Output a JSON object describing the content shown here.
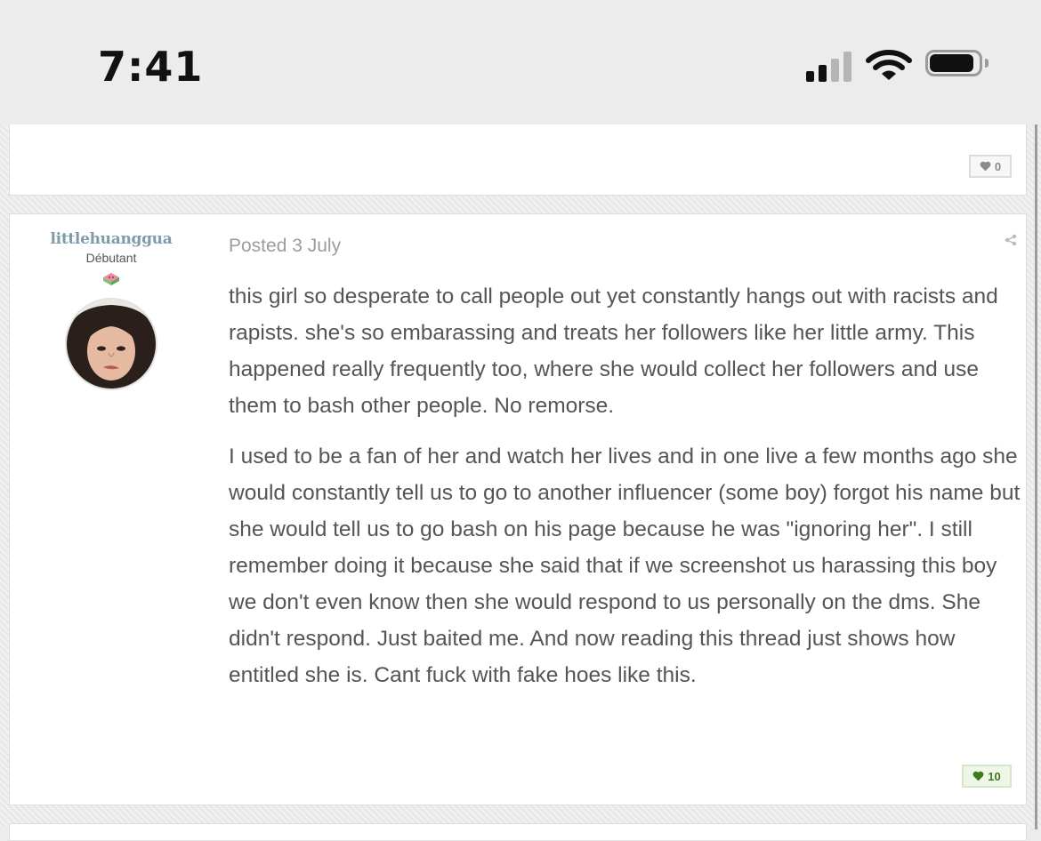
{
  "status_bar": {
    "time": "7:41",
    "signal_bars_active": 2,
    "signal_bars_total": 4,
    "battery_level": 0.9
  },
  "previous_post": {
    "reaction_count": "0"
  },
  "post": {
    "author": {
      "username": "littlehuanggua",
      "rank": "Débutant",
      "rank_badge_icon": "watermelon-badge-icon",
      "avatar_icon": "user-avatar-photo"
    },
    "date": "Posted 3 July",
    "paragraphs": [
      "this girl so desperate to call people out yet constantly hangs out with racists and rapists. she's so embarassing and treats her followers like her little army. This happened really frequently too, where she would collect her followers and use them to bash other people. No remorse.",
      "I used to be a fan of her and watch her lives and in one live a few months ago she would constantly tell us to go to another influencer (some boy) forgot his name but she would tell us to go bash on his page because he was \"ignoring her\". I still remember doing it because she said that if we screenshot us harassing this boy we don't even know then she would respond to us personally on the dms. She didn't respond. Just baited me. And now reading this thread just shows how entitled she is. Cant fuck with fake hoes like this."
    ],
    "reaction_count": "10"
  },
  "colors": {
    "username": "#7f9aaa",
    "reaction_positive": "#3d7a1a",
    "body_text": "#555555",
    "page_background": "#ececec"
  }
}
